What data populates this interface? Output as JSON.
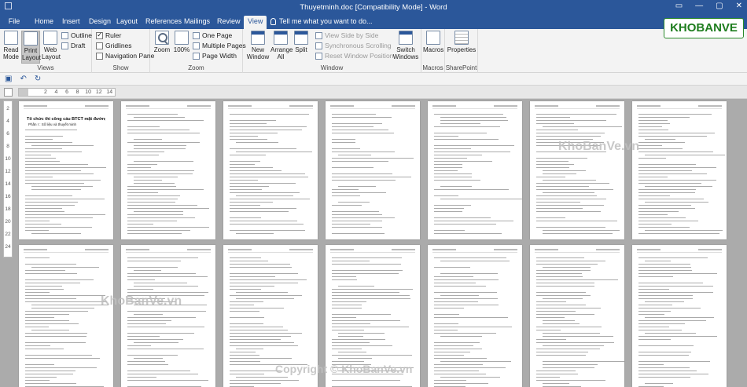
{
  "window": {
    "title": "Thuyetminh.doc [Compatibility Mode] - Word"
  },
  "tabs": [
    {
      "label": "File"
    },
    {
      "label": "Home"
    },
    {
      "label": "Insert"
    },
    {
      "label": "Design"
    },
    {
      "label": "Layout"
    },
    {
      "label": "References"
    },
    {
      "label": "Mailings"
    },
    {
      "label": "Review"
    },
    {
      "label": "View",
      "active": true
    }
  ],
  "tell_me": "Tell me what you want to do...",
  "ribbon": {
    "views": {
      "label": "Views",
      "read_mode_1": "Read",
      "read_mode_2": "Mode",
      "print_layout_1": "Print",
      "print_layout_2": "Layout",
      "web_layout_1": "Web",
      "web_layout_2": "Layout",
      "outline": "Outline",
      "draft": "Draft"
    },
    "show": {
      "label": "Show",
      "ruler": "Ruler",
      "ruler_checked": true,
      "gridlines": "Gridlines",
      "gridlines_checked": false,
      "navigation_pane": "Navigation Pane",
      "navigation_checked": false
    },
    "zoom": {
      "label": "Zoom",
      "zoom": "Zoom",
      "hundred": "100%",
      "one_page": "One Page",
      "multiple_pages": "Multiple Pages",
      "page_width": "Page Width"
    },
    "window": {
      "label": "Window",
      "new_window_1": "New",
      "new_window_2": "Window",
      "arrange_all_1": "Arrange",
      "arrange_all_2": "All",
      "split": "Split",
      "view_side_by_side": "View Side by Side",
      "synchronous_scrolling": "Synchronous Scrolling",
      "reset_window_position": "Reset Window Position",
      "switch_windows_1": "Switch",
      "switch_windows_2": "Windows"
    },
    "macros": {
      "label": "Macros",
      "macros": "Macros"
    },
    "sharepoint": {
      "label": "SharePoint",
      "properties": "Properties"
    }
  },
  "ruler": {
    "ticks": [
      "2",
      "",
      "2",
      "4",
      "6",
      "8",
      "10",
      "12",
      "14"
    ]
  },
  "vertical_ruler": {
    "ticks": [
      "2",
      "4",
      "6",
      "8",
      "10",
      "12",
      "14",
      "16",
      "18",
      "20",
      "22",
      "24"
    ]
  },
  "document": {
    "page_heading": "Tổ chức thi công cầu BTCT mặt đường",
    "page_subheading": "Phần I : Số liệu và thuyết minh"
  },
  "watermarks": {
    "logo": "KHOBANVE",
    "text": "KhoBanVe.vn",
    "copyright": "Copyright © KhoBanVe.vn"
  },
  "colors": {
    "accent": "#2b579a",
    "ribbon_bg": "#f3f3f3",
    "workspace": "#ababab"
  }
}
